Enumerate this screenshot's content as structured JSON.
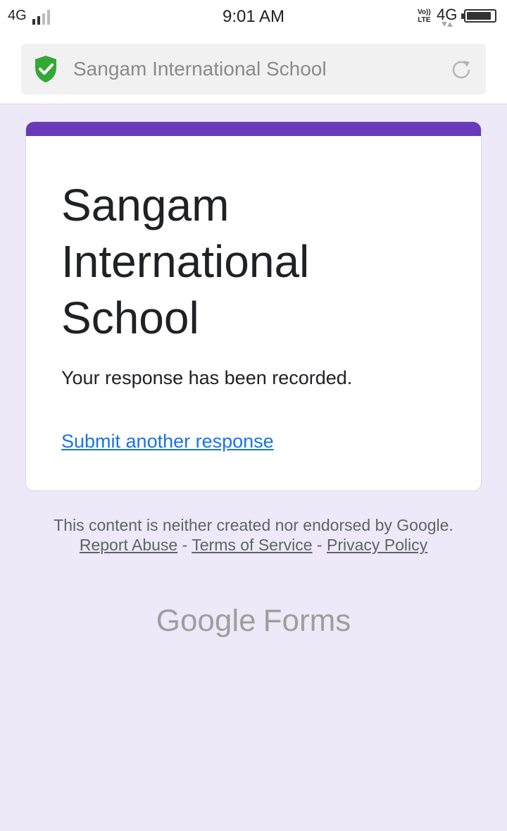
{
  "status_bar": {
    "network_left": "4G",
    "time": "9:01 AM",
    "volte_top": "Vo))",
    "volte_bottom": "LTE",
    "network_right": "4G",
    "battery_level": 0.9
  },
  "browser": {
    "url_text": "Sangam International School",
    "shield_color": "#34a835"
  },
  "form": {
    "title": "Sangam International School",
    "confirmation": "Your response has been recorded.",
    "submit_another": "Submit another response",
    "accent_color": "#673ab7"
  },
  "footer": {
    "disclaimer_text": "This content is neither created nor endorsed by Google.",
    "report_abuse": "Report Abuse",
    "separator": "-",
    "terms": "Terms of Service",
    "privacy": "Privacy Policy",
    "brand_google": "Google",
    "brand_forms": "Forms"
  }
}
